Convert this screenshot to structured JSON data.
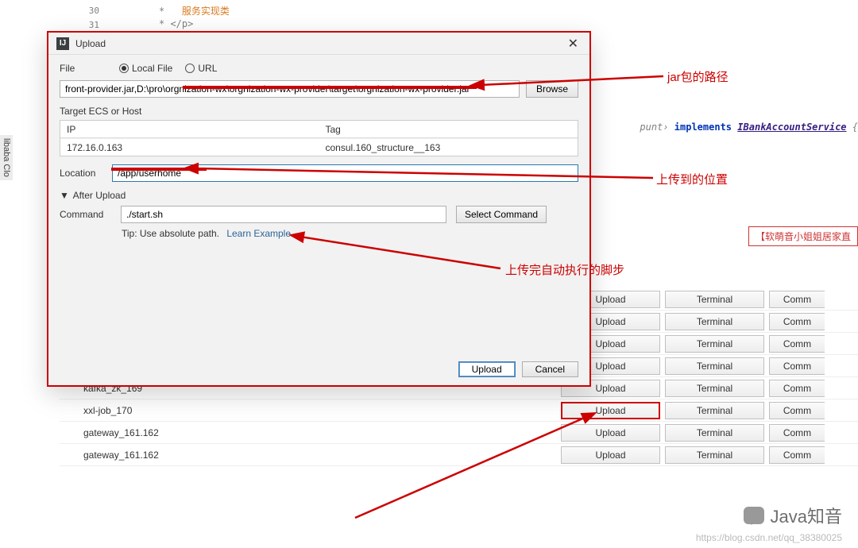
{
  "editor": {
    "line_no_1": "30",
    "line_no_2": "31",
    "star": "*",
    "comment": "服务实现类",
    "line2": "* </p>",
    "impl_frag1": "punt",
    "kw_implements": "implements",
    "iface": "IBankAccountService",
    "brace": " {"
  },
  "sidebar_tab": "libaba Clo",
  "notice": "【软萌音小姐姐居家直",
  "dialog": {
    "title": "Upload",
    "file_label": "File",
    "radio_local": "Local File",
    "radio_url": "URL",
    "file_path": "front-provider.jar,D:\\pro\\orgnization-wx\\orgnization-wx-provider\\target\\orgnization-wx-provider.jar",
    "browse": "Browse",
    "target_label": "Target ECS or Host",
    "col_ip": "IP",
    "col_tag": "Tag",
    "row_ip": "172.16.0.163",
    "row_tag": "consul.160_structure__163",
    "location_label": "Location",
    "location_value": "/app/userhome",
    "after_upload": "After Upload",
    "caret": "▼",
    "command_label": "Command",
    "command_value": "./start.sh",
    "select_command": "Select Command",
    "tip": "Tip: Use absolute path.",
    "learn": "Learn Example",
    "btn_upload": "Upload",
    "btn_cancel": "Cancel"
  },
  "hosts": {
    "r5": "kafka_zk_169",
    "r6": "xxl-job_170",
    "r7": "gateway_161.162",
    "r8": "gateway_161.162",
    "upload": "Upload",
    "terminal": "Terminal",
    "comm": "Comm"
  },
  "annotations": {
    "a1": "jar包的路径",
    "a2": "上传到的位置",
    "a3": "上传完自动执行的脚步"
  },
  "watermark": "Java知音",
  "credit": "https://blog.csdn.net/qq_38380025"
}
